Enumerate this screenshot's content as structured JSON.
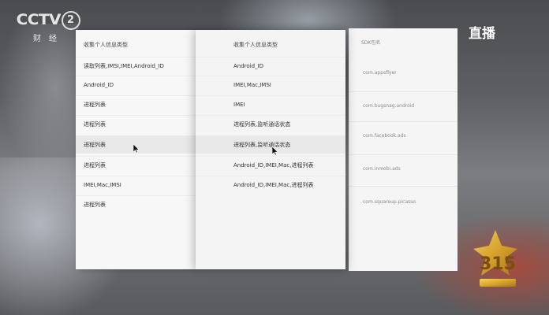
{
  "logo": {
    "channel_text": "CCTV",
    "channel_number": "2",
    "channel_sub": "财经"
  },
  "live_label": "直播",
  "badge_text": "315",
  "left_panel": {
    "header": "收集个人信息类型",
    "rows": [
      "读取列表,IMSI,IMEI,Android_ID",
      "Android_ID",
      "进程列表",
      "进程列表",
      "进程列表",
      "进程列表",
      "IMEI,Mac,IMSI",
      "进程列表"
    ]
  },
  "mid_panel": {
    "header": "收集个人信息类型",
    "rows": [
      "Android_ID",
      "IMEI,Mac,IMSI",
      "IMEI",
      "进程列表,监听通话状态",
      "进程列表,监听通话状态",
      "Android_ID,IMEI,Mac,进程列表",
      "Android_ID,IMEI,Mac,进程列表"
    ]
  },
  "right_panel": {
    "header": "SDK包名",
    "rows": [
      "com.appsflyer",
      "com.bugsnag.android",
      "com.facebook.ads",
      "com.inmobi.ads",
      "com.squareup.picasso"
    ]
  }
}
